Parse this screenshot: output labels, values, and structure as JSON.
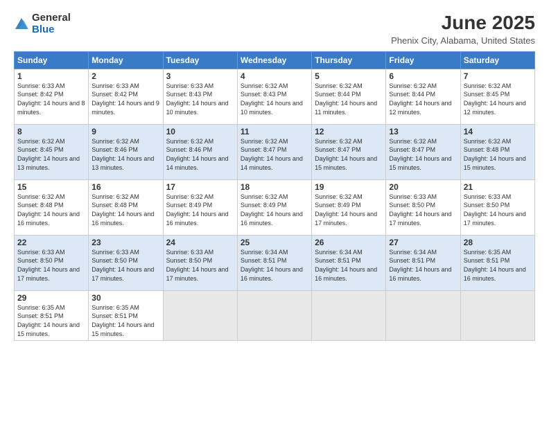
{
  "header": {
    "logo_general": "General",
    "logo_blue": "Blue",
    "month_title": "June 2025",
    "location": "Phenix City, Alabama, United States"
  },
  "columns": [
    "Sunday",
    "Monday",
    "Tuesday",
    "Wednesday",
    "Thursday",
    "Friday",
    "Saturday"
  ],
  "weeks": [
    [
      {
        "day": "1",
        "sunrise": "Sunrise: 6:33 AM",
        "sunset": "Sunset: 8:42 PM",
        "daylight": "Daylight: 14 hours and 8 minutes."
      },
      {
        "day": "2",
        "sunrise": "Sunrise: 6:33 AM",
        "sunset": "Sunset: 8:42 PM",
        "daylight": "Daylight: 14 hours and 9 minutes."
      },
      {
        "day": "3",
        "sunrise": "Sunrise: 6:33 AM",
        "sunset": "Sunset: 8:43 PM",
        "daylight": "Daylight: 14 hours and 10 minutes."
      },
      {
        "day": "4",
        "sunrise": "Sunrise: 6:32 AM",
        "sunset": "Sunset: 8:43 PM",
        "daylight": "Daylight: 14 hours and 10 minutes."
      },
      {
        "day": "5",
        "sunrise": "Sunrise: 6:32 AM",
        "sunset": "Sunset: 8:44 PM",
        "daylight": "Daylight: 14 hours and 11 minutes."
      },
      {
        "day": "6",
        "sunrise": "Sunrise: 6:32 AM",
        "sunset": "Sunset: 8:44 PM",
        "daylight": "Daylight: 14 hours and 12 minutes."
      },
      {
        "day": "7",
        "sunrise": "Sunrise: 6:32 AM",
        "sunset": "Sunset: 8:45 PM",
        "daylight": "Daylight: 14 hours and 12 minutes."
      }
    ],
    [
      {
        "day": "8",
        "sunrise": "Sunrise: 6:32 AM",
        "sunset": "Sunset: 8:45 PM",
        "daylight": "Daylight: 14 hours and 13 minutes."
      },
      {
        "day": "9",
        "sunrise": "Sunrise: 6:32 AM",
        "sunset": "Sunset: 8:46 PM",
        "daylight": "Daylight: 14 hours and 13 minutes."
      },
      {
        "day": "10",
        "sunrise": "Sunrise: 6:32 AM",
        "sunset": "Sunset: 8:46 PM",
        "daylight": "Daylight: 14 hours and 14 minutes."
      },
      {
        "day": "11",
        "sunrise": "Sunrise: 6:32 AM",
        "sunset": "Sunset: 8:47 PM",
        "daylight": "Daylight: 14 hours and 14 minutes."
      },
      {
        "day": "12",
        "sunrise": "Sunrise: 6:32 AM",
        "sunset": "Sunset: 8:47 PM",
        "daylight": "Daylight: 14 hours and 15 minutes."
      },
      {
        "day": "13",
        "sunrise": "Sunrise: 6:32 AM",
        "sunset": "Sunset: 8:47 PM",
        "daylight": "Daylight: 14 hours and 15 minutes."
      },
      {
        "day": "14",
        "sunrise": "Sunrise: 6:32 AM",
        "sunset": "Sunset: 8:48 PM",
        "daylight": "Daylight: 14 hours and 15 minutes."
      }
    ],
    [
      {
        "day": "15",
        "sunrise": "Sunrise: 6:32 AM",
        "sunset": "Sunset: 8:48 PM",
        "daylight": "Daylight: 14 hours and 16 minutes."
      },
      {
        "day": "16",
        "sunrise": "Sunrise: 6:32 AM",
        "sunset": "Sunset: 8:48 PM",
        "daylight": "Daylight: 14 hours and 16 minutes."
      },
      {
        "day": "17",
        "sunrise": "Sunrise: 6:32 AM",
        "sunset": "Sunset: 8:49 PM",
        "daylight": "Daylight: 14 hours and 16 minutes."
      },
      {
        "day": "18",
        "sunrise": "Sunrise: 6:32 AM",
        "sunset": "Sunset: 8:49 PM",
        "daylight": "Daylight: 14 hours and 16 minutes."
      },
      {
        "day": "19",
        "sunrise": "Sunrise: 6:32 AM",
        "sunset": "Sunset: 8:49 PM",
        "daylight": "Daylight: 14 hours and 17 minutes."
      },
      {
        "day": "20",
        "sunrise": "Sunrise: 6:33 AM",
        "sunset": "Sunset: 8:50 PM",
        "daylight": "Daylight: 14 hours and 17 minutes."
      },
      {
        "day": "21",
        "sunrise": "Sunrise: 6:33 AM",
        "sunset": "Sunset: 8:50 PM",
        "daylight": "Daylight: 14 hours and 17 minutes."
      }
    ],
    [
      {
        "day": "22",
        "sunrise": "Sunrise: 6:33 AM",
        "sunset": "Sunset: 8:50 PM",
        "daylight": "Daylight: 14 hours and 17 minutes."
      },
      {
        "day": "23",
        "sunrise": "Sunrise: 6:33 AM",
        "sunset": "Sunset: 8:50 PM",
        "daylight": "Daylight: 14 hours and 17 minutes."
      },
      {
        "day": "24",
        "sunrise": "Sunrise: 6:33 AM",
        "sunset": "Sunset: 8:50 PM",
        "daylight": "Daylight: 14 hours and 17 minutes."
      },
      {
        "day": "25",
        "sunrise": "Sunrise: 6:34 AM",
        "sunset": "Sunset: 8:51 PM",
        "daylight": "Daylight: 14 hours and 16 minutes."
      },
      {
        "day": "26",
        "sunrise": "Sunrise: 6:34 AM",
        "sunset": "Sunset: 8:51 PM",
        "daylight": "Daylight: 14 hours and 16 minutes."
      },
      {
        "day": "27",
        "sunrise": "Sunrise: 6:34 AM",
        "sunset": "Sunset: 8:51 PM",
        "daylight": "Daylight: 14 hours and 16 minutes."
      },
      {
        "day": "28",
        "sunrise": "Sunrise: 6:35 AM",
        "sunset": "Sunset: 8:51 PM",
        "daylight": "Daylight: 14 hours and 16 minutes."
      }
    ],
    [
      {
        "day": "29",
        "sunrise": "Sunrise: 6:35 AM",
        "sunset": "Sunset: 8:51 PM",
        "daylight": "Daylight: 14 hours and 15 minutes."
      },
      {
        "day": "30",
        "sunrise": "Sunrise: 6:35 AM",
        "sunset": "Sunset: 8:51 PM",
        "daylight": "Daylight: 14 hours and 15 minutes."
      },
      null,
      null,
      null,
      null,
      null
    ]
  ]
}
